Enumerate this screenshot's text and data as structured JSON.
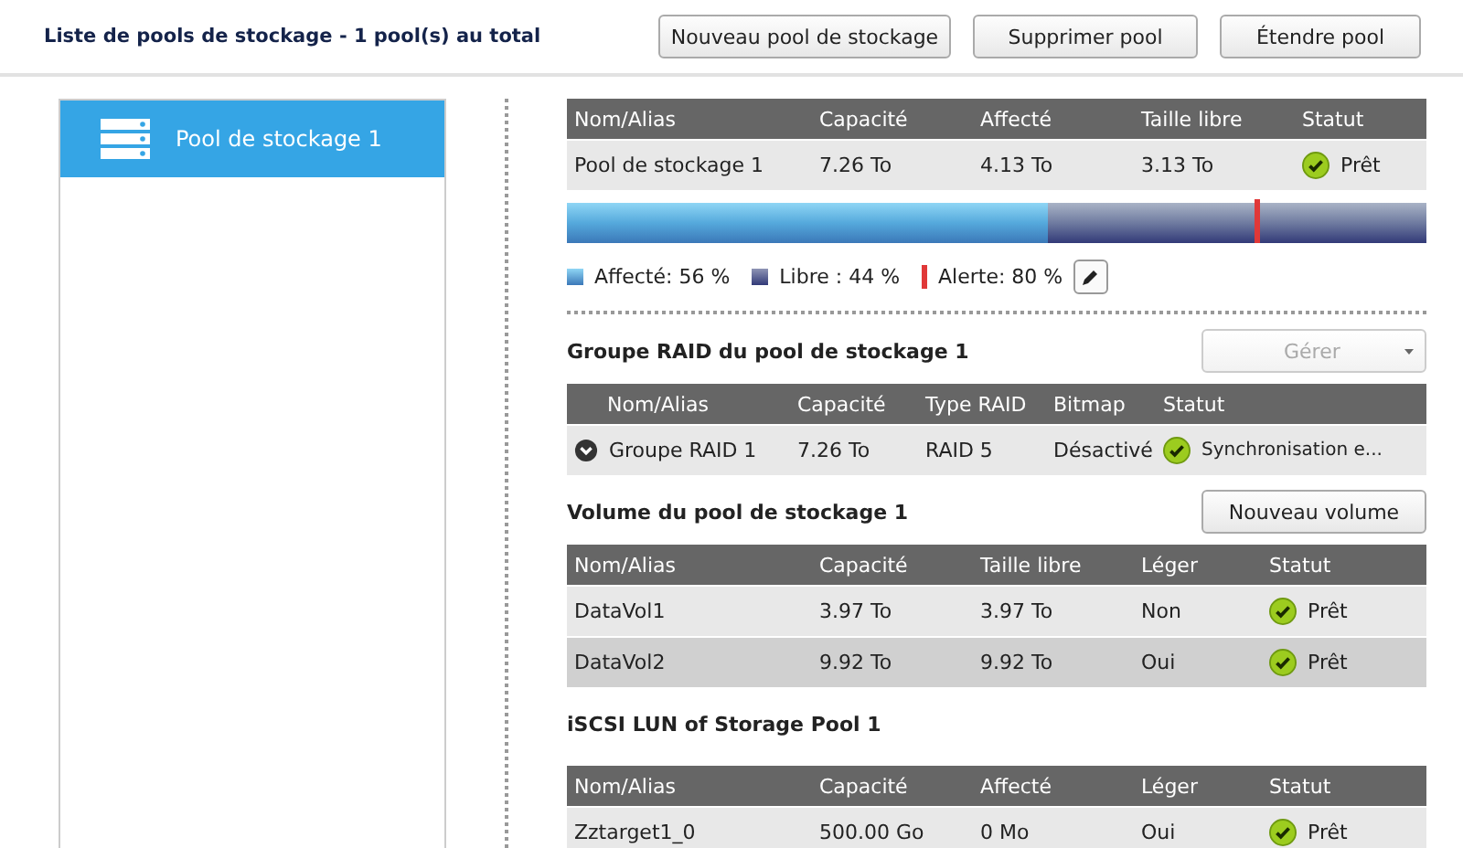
{
  "header": {
    "title": "Liste de pools de stockage - 1 pool(s) au total",
    "buttons": [
      "Nouveau pool de stockage",
      "Supprimer pool",
      "Étendre pool"
    ]
  },
  "sidebar": {
    "items": [
      {
        "label": "Pool de stockage 1",
        "selected": true
      }
    ]
  },
  "pool_table": {
    "columns": [
      "Nom/Alias",
      "Capacité",
      "Affecté",
      "Taille libre",
      "Statut"
    ],
    "rows": [
      {
        "cells": [
          "Pool de stockage 1",
          "7.26 To",
          "4.13 To",
          "3.13 To"
        ],
        "status": "Prêt"
      }
    ]
  },
  "usage_bar": {
    "level": 0.56
  },
  "alert_marker": {
    "level": 0.8
  },
  "legend": [
    "Affecté: 56 %",
    "Libre : 44 %",
    "Alerte: 80 %"
  ],
  "raid_section": {
    "title": "Groupe RAID du pool de stockage 1",
    "button": {
      "label": "Gérer",
      "disabled": true
    },
    "columns": [
      "Nom/Alias",
      "Capacité",
      "Type RAID",
      "Bitmap",
      "Statut"
    ],
    "rows": [
      {
        "cells": [
          "Groupe RAID 1",
          "7.26 To",
          "RAID 5",
          "Désactivé"
        ],
        "status": "Synchronisation e..."
      }
    ]
  },
  "volume_section": {
    "title": "Volume du pool de stockage 1",
    "button": {
      "label": "Nouveau volume",
      "disabled": false
    },
    "columns": [
      "Nom/Alias",
      "Capacité",
      "Taille libre",
      "Léger",
      "Statut"
    ],
    "rows": [
      {
        "cells": [
          "DataVol1",
          "3.97 To",
          "3.97 To",
          "Non"
        ],
        "status": "Prêt"
      },
      {
        "cells": [
          "DataVol2",
          "9.92 To",
          "9.92 To",
          "Oui"
        ],
        "status": "Prêt"
      }
    ]
  },
  "lun_section": {
    "title": "iSCSI LUN of Storage Pool 1",
    "columns": [
      "Nom/Alias",
      "Capacité",
      "Affecté",
      "Léger",
      "Statut"
    ],
    "rows": [
      {
        "cells": [
          "Zztarget1_0",
          "500.00 Go",
          "0 Mo",
          "Oui"
        ],
        "status": "Prêt"
      }
    ]
  }
}
